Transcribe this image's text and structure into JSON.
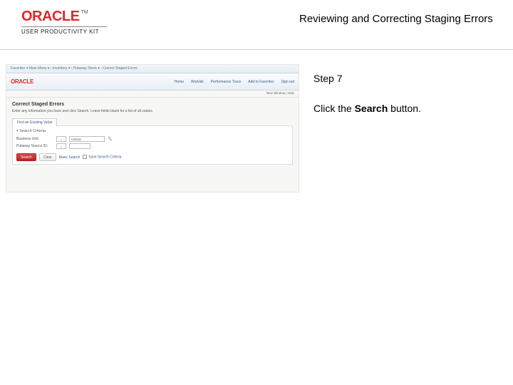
{
  "header": {
    "brand": "ORACLE",
    "tm": "TM",
    "subtitle": "USER PRODUCTIVITY KIT",
    "page_title": "Reviewing and Correcting Staging Errors"
  },
  "instructions": {
    "step_label": "Step 7",
    "text_before": "Click the ",
    "bold_word": "Search",
    "text_after": " button."
  },
  "screenshot": {
    "breadcrumb": "Favorites ▾   Main Menu ▾  › Inventory ▾ › Putaway Stock ▾ › Correct Staged Errors",
    "brand": "ORACLE",
    "nav": [
      "Home",
      "Worklist",
      "Performance Trace",
      "Add to Favorites",
      "Sign out"
    ],
    "subbar": "New Window | Help",
    "heading": "Correct Staged Errors",
    "description": "Enter any information you have and click Search. Leave fields blank for a list of all values.",
    "tab": "Find an Existing Value",
    "section_title": "Search Criteria",
    "fields": [
      {
        "label": "Business Unit:",
        "op": "=",
        "value": "US010",
        "lookup": true
      },
      {
        "label": "Putaway Source ID:",
        "op": "=",
        "value": "",
        "lookup": false
      }
    ],
    "buttons": {
      "search": "Search",
      "clear": "Clear",
      "basic": "Basic Search",
      "save": "Save Search Criteria"
    }
  }
}
